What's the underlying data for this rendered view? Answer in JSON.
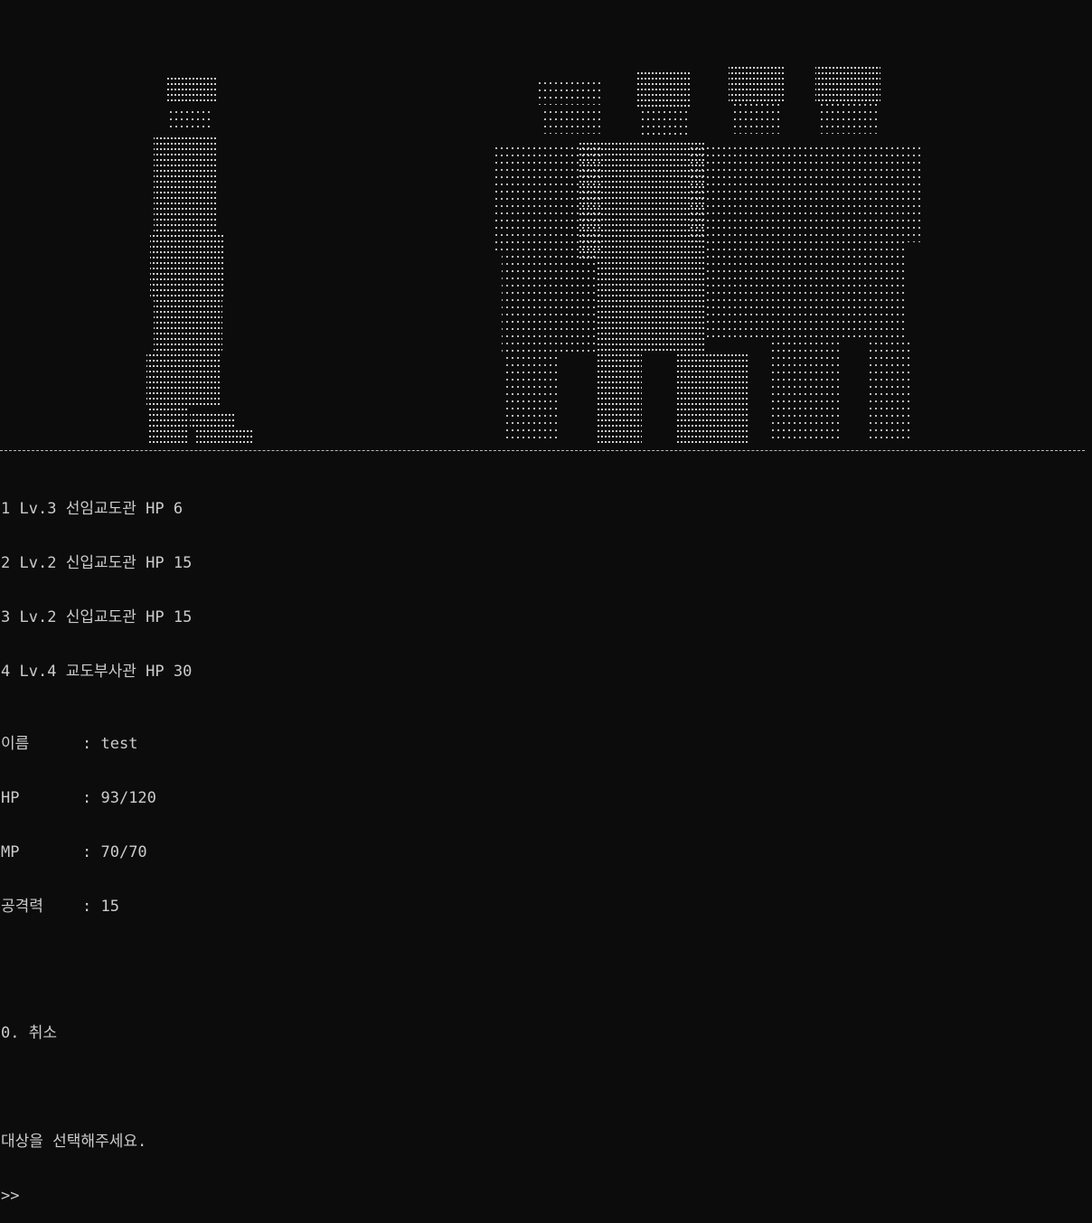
{
  "monsters": [
    {
      "index": "1",
      "level": "Lv.3",
      "name": "선임교도관",
      "hp_label": "HP",
      "hp": "6"
    },
    {
      "index": "2",
      "level": "Lv.2",
      "name": "신입교도관",
      "hp_label": "HP",
      "hp": "15"
    },
    {
      "index": "3",
      "level": "Lv.2",
      "name": "신입교도관",
      "hp_label": "HP",
      "hp": "15"
    },
    {
      "index": "4",
      "level": "Lv.4",
      "name": "교도부사관",
      "hp_label": "HP",
      "hp": "30"
    }
  ],
  "player": {
    "name_label": "이름",
    "name": "test",
    "hp_label": "HP",
    "hp": "93/120",
    "mp_label": "MP",
    "mp": "70/70",
    "atk_label": "공격력",
    "atk": "15"
  },
  "cancel_option": "0. 취소",
  "instruction": "대상을 선택해주세요.",
  "prompt": ">>",
  "colors": {
    "background": "#0c0c0c",
    "text": "#cccccc",
    "art": "#d0d0d0"
  }
}
